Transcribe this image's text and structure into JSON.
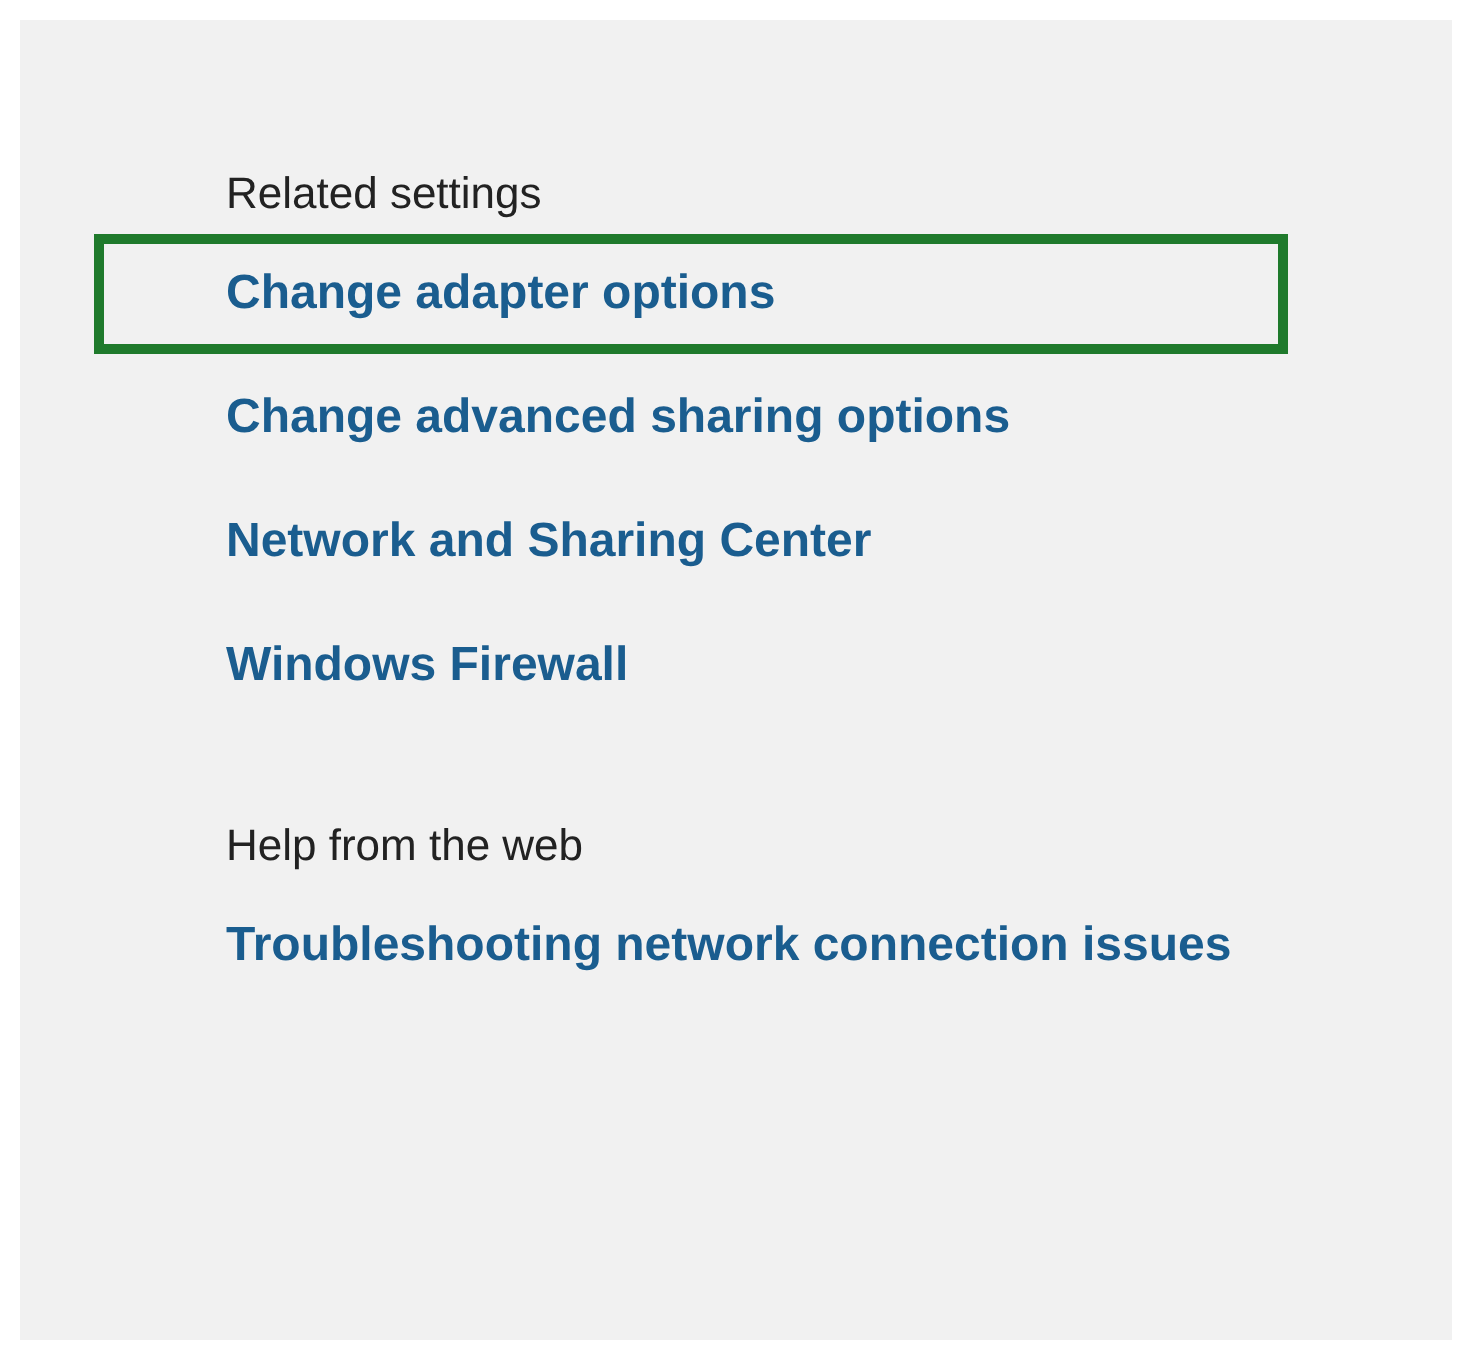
{
  "sections": [
    {
      "heading": "Related settings",
      "links": [
        {
          "label": "Change adapter options",
          "highlighted": true
        },
        {
          "label": "Change advanced sharing options",
          "highlighted": false
        },
        {
          "label": "Network and Sharing Center",
          "highlighted": false
        },
        {
          "label": "Windows Firewall",
          "highlighted": false
        }
      ]
    },
    {
      "heading": "Help from the web",
      "links": [
        {
          "label": "Troubleshooting network connection issues",
          "highlighted": false
        }
      ]
    }
  ]
}
